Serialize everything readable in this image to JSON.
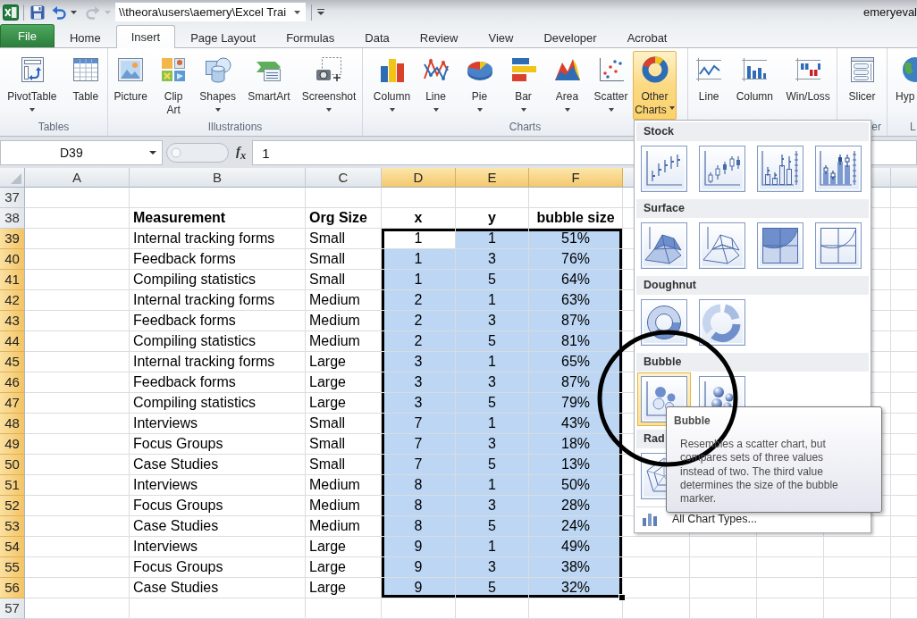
{
  "title_bar": {
    "quick_access": [
      {
        "disabled": false
      },
      {
        "disabled": false
      },
      {
        "disabled": true
      }
    ],
    "path": "\\\\theora\\users\\aemery\\Excel Trai",
    "user": "emeryeval"
  },
  "tabs": [
    {
      "label": "File",
      "kind": "file",
      "selected": false
    },
    {
      "label": "Home",
      "kind": "tab",
      "selected": false
    },
    {
      "label": "Insert",
      "kind": "tab",
      "selected": true
    },
    {
      "label": "Page Layout",
      "kind": "tab",
      "selected": false
    },
    {
      "label": "Formulas",
      "kind": "tab",
      "selected": false
    },
    {
      "label": "Data",
      "kind": "tab",
      "selected": false
    },
    {
      "label": "Review",
      "kind": "tab",
      "selected": false
    },
    {
      "label": "View",
      "kind": "tab",
      "selected": false
    },
    {
      "label": "Developer",
      "kind": "tab",
      "selected": false
    },
    {
      "label": "Acrobat",
      "kind": "tab",
      "selected": false
    }
  ],
  "ribbon": {
    "groups": [
      {
        "label": "Tables",
        "buttons": [
          {
            "label": "PivotTable",
            "dropdown": true,
            "open": false
          },
          {
            "label": "Table",
            "dropdown": false,
            "open": false
          }
        ]
      },
      {
        "label": "Illustrations",
        "buttons": [
          {
            "label": "Picture",
            "dropdown": false,
            "open": false
          },
          {
            "label": "Clip Art",
            "dropdown": false,
            "open": false
          },
          {
            "label": "Shapes",
            "dropdown": true,
            "open": false
          },
          {
            "label": "SmartArt",
            "dropdown": false,
            "open": false
          },
          {
            "label": "Screenshot",
            "dropdown": true,
            "open": false
          }
        ]
      },
      {
        "label": "Charts",
        "buttons": [
          {
            "label": "Column",
            "dropdown": true,
            "open": false
          },
          {
            "label": "Line",
            "dropdown": true,
            "open": false
          },
          {
            "label": "Pie",
            "dropdown": true,
            "open": false
          },
          {
            "label": "Bar",
            "dropdown": true,
            "open": false
          },
          {
            "label": "Area",
            "dropdown": true,
            "open": false
          },
          {
            "label": "Scatter",
            "dropdown": true,
            "open": false
          },
          {
            "label": "Other Charts",
            "dropdown": true,
            "open": true
          }
        ]
      },
      {
        "buttons": [
          {
            "label": "Line",
            "dropdown": false,
            "open": false
          },
          {
            "label": "Column",
            "dropdown": false,
            "open": false
          },
          {
            "label": "Win/Loss",
            "dropdown": false,
            "open": false
          }
        ]
      },
      {
        "label": "er",
        "buttons": [
          {
            "label": "Slicer",
            "dropdown": false,
            "open": false
          }
        ]
      },
      {
        "label": "L",
        "buttons": [
          {
            "label": "Hyp",
            "dropdown": false,
            "open": false
          }
        ]
      }
    ]
  },
  "formula_bar": {
    "name_box": "D39",
    "insert_function": "f$_{x}$",
    "formula": "1"
  },
  "sheet": {
    "columns": [
      {
        "label": "A",
        "selected": false,
        "active": false
      },
      {
        "label": "B",
        "selected": false,
        "active": false
      },
      {
        "label": "C",
        "selected": false,
        "active": false
      },
      {
        "label": "D",
        "selected": true,
        "active": true
      },
      {
        "label": "E",
        "selected": true,
        "active": false
      },
      {
        "label": "F",
        "selected": true,
        "active": false
      }
    ],
    "rows": [
      {
        "number": "37",
        "kind": "blank",
        "selected": false,
        "active": false
      },
      {
        "number": "38",
        "kind": "header",
        "selected": false,
        "active": false,
        "cells": [
          "Measurement",
          "Org Size",
          "x",
          "y",
          "bubble size"
        ]
      },
      {
        "number": "39",
        "kind": "data",
        "selected": true,
        "active": true,
        "cells": [
          "Internal tracking forms",
          "Small",
          "1",
          "1",
          "51%"
        ]
      },
      {
        "number": "40",
        "kind": "data",
        "selected": true,
        "active": false,
        "cells": [
          "Feedback forms",
          "Small",
          "1",
          "3",
          "76%"
        ]
      },
      {
        "number": "41",
        "kind": "data",
        "selected": true,
        "active": false,
        "cells": [
          "Compiling statistics",
          "Small",
          "1",
          "5",
          "64%"
        ]
      },
      {
        "number": "42",
        "kind": "data",
        "selected": true,
        "active": false,
        "cells": [
          "Internal tracking forms",
          "Medium",
          "2",
          "1",
          "63%"
        ]
      },
      {
        "number": "43",
        "kind": "data",
        "selected": true,
        "active": false,
        "cells": [
          "Feedback forms",
          "Medium",
          "2",
          "3",
          "87%"
        ]
      },
      {
        "number": "44",
        "kind": "data",
        "selected": true,
        "active": false,
        "cells": [
          "Compiling statistics",
          "Medium",
          "2",
          "5",
          "81%"
        ]
      },
      {
        "number": "45",
        "kind": "data",
        "selected": true,
        "active": false,
        "cells": [
          "Internal tracking forms",
          "Large",
          "3",
          "1",
          "65%"
        ]
      },
      {
        "number": "46",
        "kind": "data",
        "selected": true,
        "active": false,
        "cells": [
          "Feedback forms",
          "Large",
          "3",
          "3",
          "87%"
        ]
      },
      {
        "number": "47",
        "kind": "data",
        "selected": true,
        "active": false,
        "cells": [
          "Compiling statistics",
          "Large",
          "3",
          "5",
          "79%"
        ]
      },
      {
        "number": "48",
        "kind": "data",
        "selected": true,
        "active": false,
        "cells": [
          "Interviews",
          "Small",
          "7",
          "1",
          "43%"
        ]
      },
      {
        "number": "49",
        "kind": "data",
        "selected": true,
        "active": false,
        "cells": [
          "Focus Groups",
          "Small",
          "7",
          "3",
          "18%"
        ]
      },
      {
        "number": "50",
        "kind": "data",
        "selected": true,
        "active": false,
        "cells": [
          "Case Studies",
          "Small",
          "7",
          "5",
          "13%"
        ]
      },
      {
        "number": "51",
        "kind": "data",
        "selected": true,
        "active": false,
        "cells": [
          "Interviews",
          "Medium",
          "8",
          "1",
          "50%"
        ]
      },
      {
        "number": "52",
        "kind": "data",
        "selected": true,
        "active": false,
        "cells": [
          "Focus Groups",
          "Medium",
          "8",
          "3",
          "28%"
        ]
      },
      {
        "number": "53",
        "kind": "data",
        "selected": true,
        "active": false,
        "cells": [
          "Case Studies",
          "Medium",
          "8",
          "5",
          "24%"
        ]
      },
      {
        "number": "54",
        "kind": "data",
        "selected": true,
        "active": false,
        "cells": [
          "Interviews",
          "Large",
          "9",
          "1",
          "49%"
        ]
      },
      {
        "number": "55",
        "kind": "data",
        "selected": true,
        "active": false,
        "cells": [
          "Focus Groups",
          "Large",
          "9",
          "3",
          "38%"
        ]
      },
      {
        "number": "56",
        "kind": "data",
        "selected": true,
        "active": false,
        "cells": [
          "Case Studies",
          "Large",
          "9",
          "5",
          "32%"
        ]
      },
      {
        "number": "57",
        "kind": "blank",
        "selected": false,
        "active": false
      }
    ]
  },
  "chart_menu": {
    "sections": [
      {
        "label": "Stock",
        "items": [
          {
            "selected": false
          },
          {
            "selected": false
          },
          {
            "selected": false
          },
          {
            "selected": false
          }
        ]
      },
      {
        "label": "Surface",
        "items": [
          {
            "selected": false
          },
          {
            "selected": false
          },
          {
            "selected": false
          },
          {
            "selected": false
          }
        ]
      },
      {
        "label": "Doughnut",
        "items": [
          {
            "selected": false
          },
          {
            "selected": false
          }
        ]
      },
      {
        "label": "Bubble",
        "items": [
          {
            "selected": true
          },
          {
            "selected": false
          }
        ]
      },
      {
        "label": "Rad",
        "items": [
          {
            "selected": false
          }
        ]
      }
    ],
    "footer": "All Chart Types..."
  },
  "tooltip": {
    "title": "Bubble",
    "text": "Resembles a scatter chart, but compares sets of three values instead of two. The third value determines the size of the bubble marker."
  }
}
